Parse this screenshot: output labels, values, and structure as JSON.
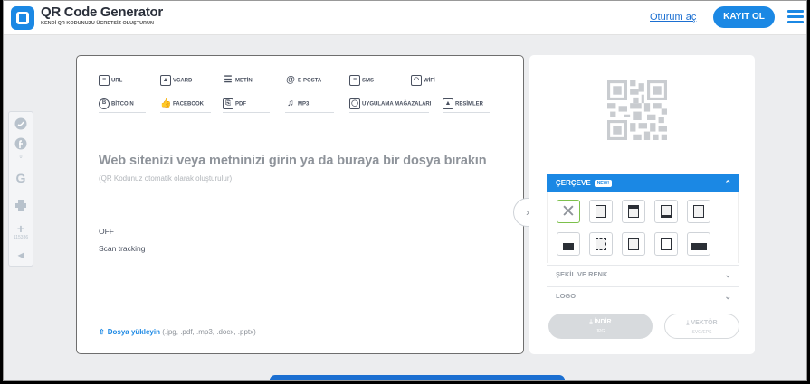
{
  "header": {
    "title": "QR Code Generator",
    "tagline": "KENDİ QR KODUNUZU ÜCRETSİZ OLUŞTURUN",
    "login": "Oturum aç",
    "signup": "KAYIT OL"
  },
  "sharebar": {
    "facebook_count": "0",
    "add_count": "115336"
  },
  "tabs": [
    {
      "label": "URL",
      "icon": "url-icon"
    },
    {
      "label": "VCARD",
      "icon": "vcard-icon"
    },
    {
      "label": "METİN",
      "icon": "text-icon"
    },
    {
      "label": "E-POSTA",
      "icon": "email-icon"
    },
    {
      "label": "SMS",
      "icon": "sms-icon"
    },
    {
      "label": "WİFİ",
      "icon": "wifi-icon"
    },
    {
      "label": "BİTCOİN",
      "icon": "bitcoin-icon"
    },
    {
      "label": "FACEBOOK",
      "icon": "facebook-like-icon"
    },
    {
      "label": "PDF",
      "icon": "pdf-icon"
    },
    {
      "label": "MP3",
      "icon": "music-icon"
    },
    {
      "label": "UYGULAMA MAĞAZALARI",
      "icon": "app-store-icon"
    },
    {
      "label": "RESİMLER",
      "icon": "image-icon"
    }
  ],
  "main": {
    "prompt": "Web sitenizi veya metninizi girin ya da buraya bir dosya bırakın",
    "subprompt": "(QR Kodunuz otomatik olarak oluşturulur)",
    "toggle_state": "OFF",
    "scan_tracking": "Scan tracking",
    "upload_link": "Dosya yükleyin",
    "upload_formats": "(.jpg, .pdf, .mp3, .docx, .pptx)"
  },
  "panel": {
    "frame_label": "ÇERÇEVE",
    "new_badge": "NEW!",
    "shape_color": "ŞEKİL VE RENK",
    "logo": "LOGO",
    "download_label": "İNDİR",
    "download_sub": "JPG",
    "vector_label": "VEKTÖR",
    "vector_sub": "SVG/EPS"
  },
  "colors": {
    "accent": "#1b88e4",
    "selected_frame": "#7cc04b"
  }
}
